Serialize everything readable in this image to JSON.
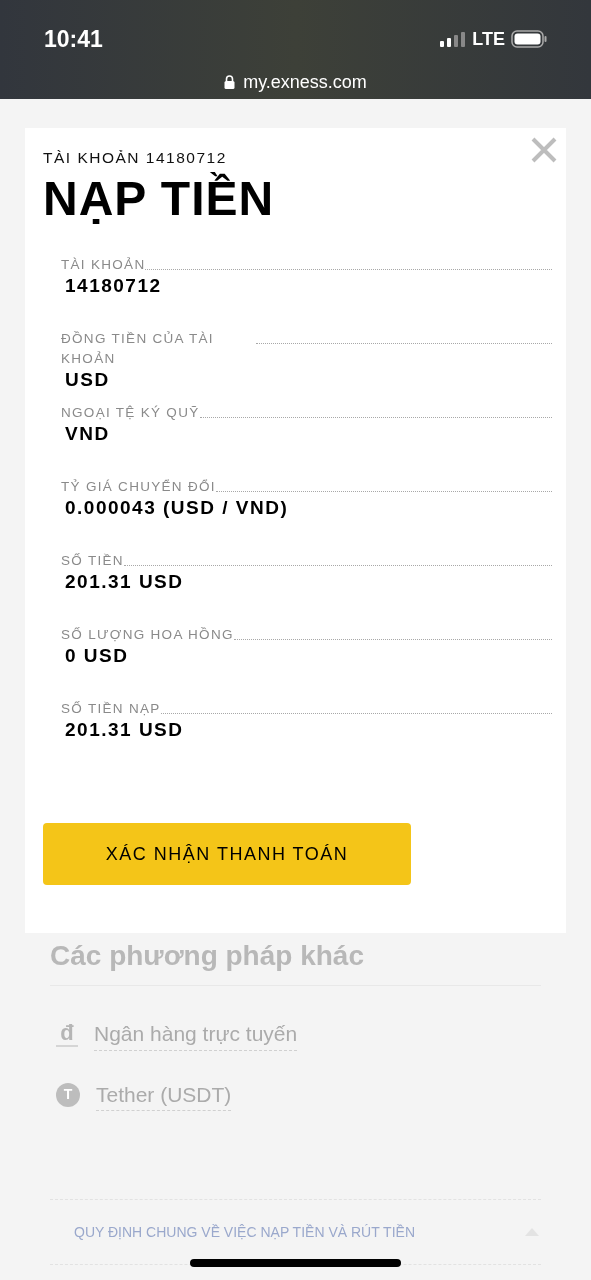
{
  "status_bar": {
    "time": "10:41",
    "network": "LTE"
  },
  "browser": {
    "url": "my.exness.com"
  },
  "modal": {
    "subtitle": "TÀI KHOẢN 14180712",
    "title": "NẠP TIỀN",
    "fields": [
      {
        "label": "TÀI KHOẢN",
        "value": "14180712"
      },
      {
        "label": "ĐỒNG TIỀN CỦA TÀI KHOẢN",
        "value": "USD"
      },
      {
        "label": "NGOẠI TỆ KÝ QUỸ",
        "value": "VND"
      },
      {
        "label": "TỶ GIÁ CHUYỂN ĐỔI",
        "value": "0.000043 (USD / VND)"
      },
      {
        "label": "SỐ TIỀN",
        "value": "201.31 USD"
      },
      {
        "label": "SỐ LƯỢNG HOA HỒNG",
        "value": "0 USD"
      },
      {
        "label": "SỐ TIỀN NẠP",
        "value": "201.31 USD"
      }
    ],
    "confirm_button": "XÁC NHẬN THANH TOÁN"
  },
  "background": {
    "heading": "Các phương pháp khác",
    "methods": [
      {
        "kind": "currency",
        "icon_text": "đ",
        "label": "Ngân hàng trực tuyến"
      },
      {
        "kind": "coin",
        "icon_text": "T",
        "label": "Tether (USDT)"
      }
    ],
    "accordion": {
      "label": "QUY ĐỊNH CHUNG VỀ VIỆC NẠP TIỀN VÀ RÚT TIỀN",
      "expanded": true
    }
  }
}
